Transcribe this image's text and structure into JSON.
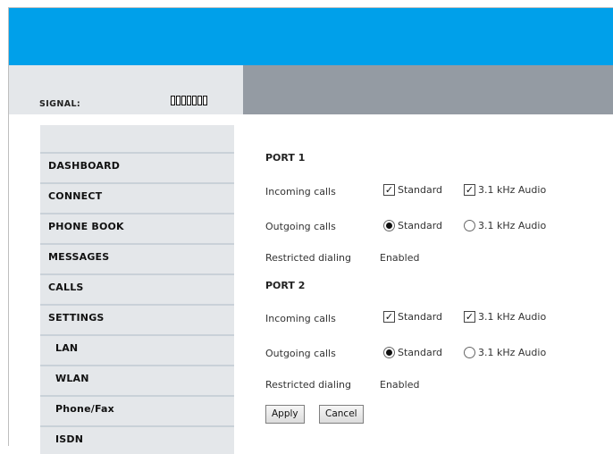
{
  "header": {
    "signal_label": "SIGNAL:",
    "signal_bars_total": 7,
    "accent_color": "#00a0ea",
    "band_color": "#949ba3"
  },
  "sidebar": {
    "items": [
      {
        "label": "DASHBOARD",
        "sub": false
      },
      {
        "label": "CONNECT",
        "sub": false
      },
      {
        "label": "PHONE BOOK",
        "sub": false
      },
      {
        "label": "MESSAGES",
        "sub": false
      },
      {
        "label": "CALLS",
        "sub": false
      },
      {
        "label": "SETTINGS",
        "sub": false
      },
      {
        "label": "LAN",
        "sub": true
      },
      {
        "label": "WLAN",
        "sub": true
      },
      {
        "label": "Phone/Fax",
        "sub": true
      },
      {
        "label": "ISDN",
        "sub": true
      }
    ]
  },
  "main": {
    "ports": [
      {
        "title": "PORT 1",
        "incoming_label": "Incoming calls",
        "incoming_options": [
          {
            "label": "Standard",
            "checked": true
          },
          {
            "label": "3.1 kHz Audio",
            "checked": true
          }
        ],
        "outgoing_label": "Outgoing calls",
        "outgoing_options": [
          {
            "label": "Standard",
            "selected": true
          },
          {
            "label": "3.1 kHz Audio",
            "selected": false
          }
        ],
        "restricted_label": "Restricted dialing",
        "restricted_value": "Enabled"
      },
      {
        "title": "PORT 2",
        "incoming_label": "Incoming calls",
        "incoming_options": [
          {
            "label": "Standard",
            "checked": true
          },
          {
            "label": "3.1 kHz Audio",
            "checked": true
          }
        ],
        "outgoing_label": "Outgoing calls",
        "outgoing_options": [
          {
            "label": "Standard",
            "selected": true
          },
          {
            "label": "3.1 kHz Audio",
            "selected": false
          }
        ],
        "restricted_label": "Restricted dialing",
        "restricted_value": "Enabled"
      }
    ],
    "apply_label": "Apply",
    "cancel_label": "Cancel"
  }
}
